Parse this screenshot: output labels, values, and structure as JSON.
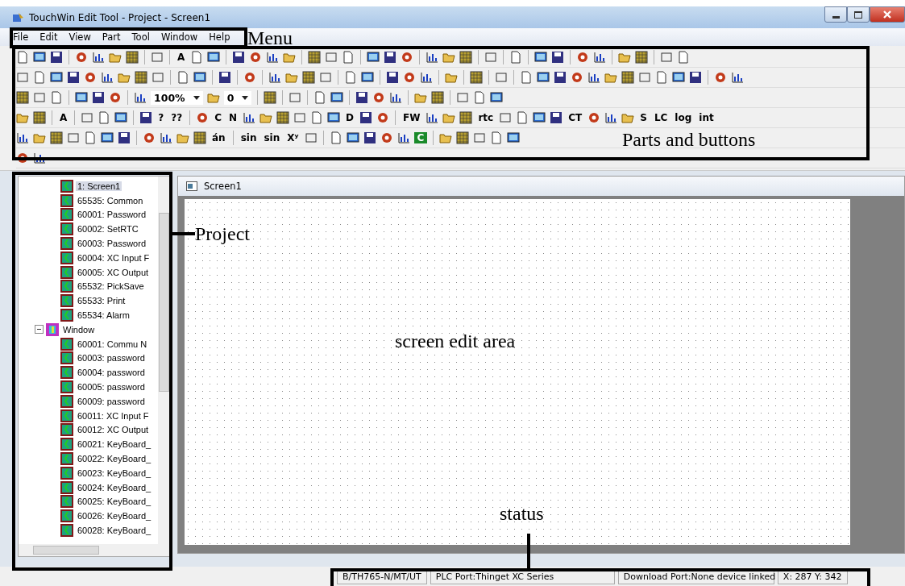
{
  "window": {
    "title": "TouchWin Edit Tool - Project - Screen1"
  },
  "menu": [
    "File",
    "Edit",
    "View",
    "Part",
    "Tool",
    "Window",
    "Help"
  ],
  "toolbars": [
    {
      "items": [
        "A"
      ]
    },
    {
      "items": [
        "100%",
        "0"
      ]
    },
    {
      "items": [
        "A",
        "?",
        "??",
        "C",
        "N",
        "D",
        "FW",
        "rtc",
        "CT",
        "S",
        "LC",
        "log",
        "int"
      ]
    },
    {
      "items": [
        "án",
        "sin",
        "sin",
        "Xʸ",
        "C"
      ]
    }
  ],
  "project_tree": {
    "items": [
      {
        "label": "1: Screen1",
        "selected": true
      },
      {
        "label": "65535: Common",
        "selected": false
      },
      {
        "label": "60001: Password",
        "selected": false
      },
      {
        "label": "60002: SetRTC",
        "selected": false
      },
      {
        "label": "60003: Password",
        "selected": false
      },
      {
        "label": "60004: XC Input F",
        "selected": false
      },
      {
        "label": "60005: XC Output",
        "selected": false
      },
      {
        "label": "65532: PickSave",
        "selected": false
      },
      {
        "label": "65533: Print",
        "selected": false
      },
      {
        "label": "65534: Alarm",
        "selected": false
      },
      {
        "label": "Window",
        "selected": false,
        "expanded": true,
        "children": [
          {
            "label": "60001: Commu N",
            "selected": false
          },
          {
            "label": "60003: password",
            "selected": false
          },
          {
            "label": "60004: password",
            "selected": false
          },
          {
            "label": "60005: password",
            "selected": false
          },
          {
            "label": "60009: password",
            "selected": false
          },
          {
            "label": "60011: XC Input F",
            "selected": false
          },
          {
            "label": "60012: XC Output",
            "selected": false
          },
          {
            "label": "60021: KeyBoard_",
            "selected": false
          },
          {
            "label": "60022: KeyBoard_",
            "selected": false
          },
          {
            "label": "60023: KeyBoard_",
            "selected": false
          },
          {
            "label": "60024: KeyBoard_",
            "selected": false
          },
          {
            "label": "60025: KeyBoard_",
            "selected": false
          },
          {
            "label": "60026: KeyBoard_",
            "selected": false
          },
          {
            "label": "60028: KeyBoard_",
            "selected": false
          }
        ]
      }
    ]
  },
  "editor": {
    "tab": "Screen1"
  },
  "status_bar": [
    "B/TH765-N/MT/UT",
    "PLC Port:Thinget XC Series",
    "Download Port:None device linked",
    "X: 287 Y: 342"
  ],
  "annotations": [
    "Menu",
    "Parts and buttons",
    "Project",
    "screen edit area",
    "status"
  ]
}
